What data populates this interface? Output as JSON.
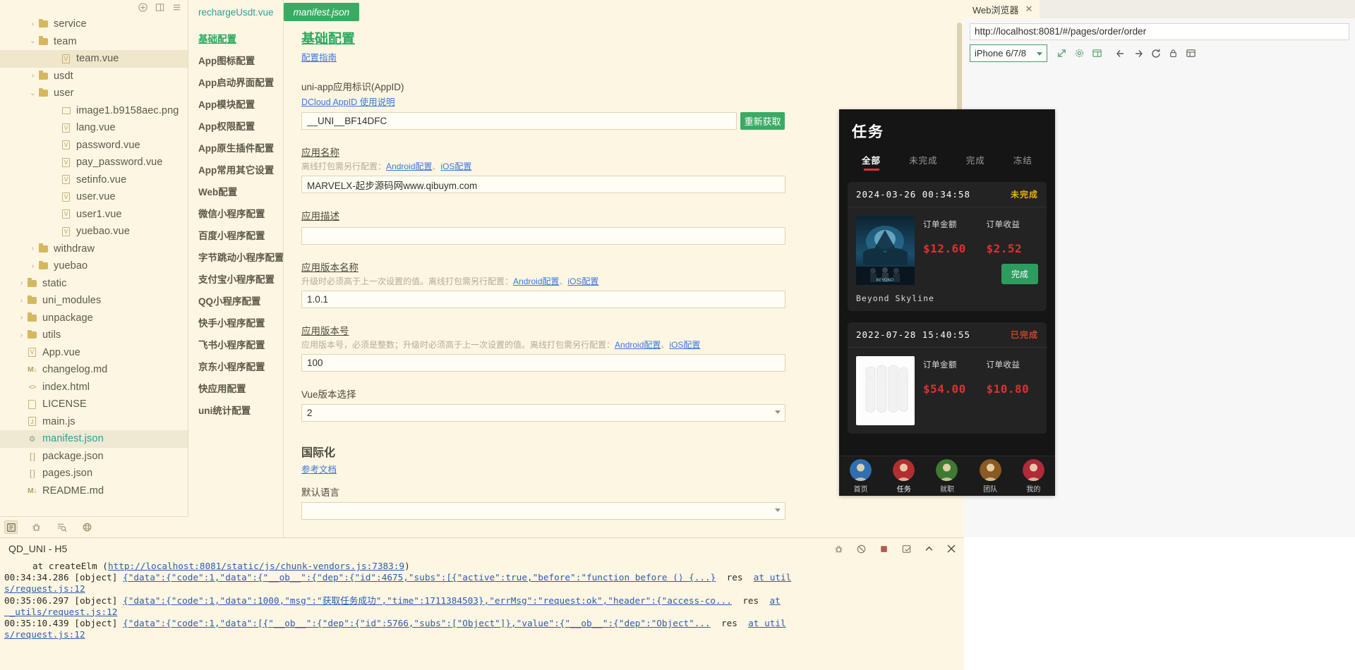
{
  "explorer": {
    "toolbar_icons": [
      "add-icon",
      "collapse-icon",
      "menu-icon"
    ],
    "items": [
      {
        "indent": 2,
        "twisty": "›",
        "icon": "folder-icon",
        "label": "service",
        "state": "collapsed"
      },
      {
        "indent": 2,
        "twisty": "⌄",
        "icon": "folder-open-icon",
        "label": "team",
        "state": "expanded"
      },
      {
        "indent": 4,
        "twisty": "",
        "icon": "vue-file-icon",
        "label": "team.vue",
        "state": "selected"
      },
      {
        "indent": 2,
        "twisty": "›",
        "icon": "folder-icon",
        "label": "usdt",
        "state": "collapsed"
      },
      {
        "indent": 2,
        "twisty": "⌄",
        "icon": "folder-open-icon",
        "label": "user",
        "state": "expanded"
      },
      {
        "indent": 4,
        "twisty": "",
        "icon": "image-file-icon",
        "label": "image1.b9158aec.png",
        "state": ""
      },
      {
        "indent": 4,
        "twisty": "",
        "icon": "vue-file-icon",
        "label": "lang.vue",
        "state": ""
      },
      {
        "indent": 4,
        "twisty": "",
        "icon": "vue-file-icon",
        "label": "password.vue",
        "state": ""
      },
      {
        "indent": 4,
        "twisty": "",
        "icon": "vue-file-icon",
        "label": "pay_password.vue",
        "state": ""
      },
      {
        "indent": 4,
        "twisty": "",
        "icon": "vue-file-icon",
        "label": "setinfo.vue",
        "state": ""
      },
      {
        "indent": 4,
        "twisty": "",
        "icon": "vue-file-icon",
        "label": "user.vue",
        "state": ""
      },
      {
        "indent": 4,
        "twisty": "",
        "icon": "vue-file-icon",
        "label": "user1.vue",
        "state": ""
      },
      {
        "indent": 4,
        "twisty": "",
        "icon": "vue-file-icon",
        "label": "yuebao.vue",
        "state": ""
      },
      {
        "indent": 2,
        "twisty": "›",
        "icon": "folder-icon",
        "label": "withdraw",
        "state": "collapsed"
      },
      {
        "indent": 2,
        "twisty": "›",
        "icon": "folder-icon",
        "label": "yuebao",
        "state": "collapsed"
      },
      {
        "indent": 1,
        "twisty": "›",
        "icon": "folder-icon",
        "label": "static",
        "state": "collapsed"
      },
      {
        "indent": 1,
        "twisty": "›",
        "icon": "folder-icon",
        "label": "uni_modules",
        "state": "collapsed"
      },
      {
        "indent": 1,
        "twisty": "›",
        "icon": "folder-icon",
        "label": "unpackage",
        "state": "collapsed"
      },
      {
        "indent": 1,
        "twisty": "›",
        "icon": "folder-icon",
        "label": "utils",
        "state": "collapsed"
      },
      {
        "indent": 1,
        "twisty": "",
        "icon": "vue-file-icon",
        "label": "App.vue",
        "state": ""
      },
      {
        "indent": 1,
        "twisty": "",
        "icon": "markdown-file-icon",
        "label": "changelog.md",
        "state": ""
      },
      {
        "indent": 1,
        "twisty": "",
        "icon": "html-file-icon",
        "label": "index.html",
        "state": ""
      },
      {
        "indent": 1,
        "twisty": "",
        "icon": "license-file-icon",
        "label": "LICENSE",
        "state": ""
      },
      {
        "indent": 1,
        "twisty": "",
        "icon": "js-file-icon",
        "label": "main.js",
        "state": ""
      },
      {
        "indent": 1,
        "twisty": "",
        "icon": "manifest-file-icon",
        "label": "manifest.json",
        "state": "active"
      },
      {
        "indent": 1,
        "twisty": "",
        "icon": "json-file-icon",
        "label": "package.json",
        "state": ""
      },
      {
        "indent": 1,
        "twisty": "",
        "icon": "json-file-icon",
        "label": "pages.json",
        "state": ""
      },
      {
        "indent": 1,
        "twisty": "",
        "icon": "markdown-file-icon",
        "label": "README.md",
        "state": ""
      }
    ],
    "footer_icons": [
      "explorer-icon",
      "debug-icon",
      "search-icon",
      "network-icon"
    ]
  },
  "editor_tabs": [
    {
      "label": "rechargeUsdt.vue",
      "active": false
    },
    {
      "label": "manifest.json",
      "active": true
    }
  ],
  "manifest_nav": [
    {
      "label": "基础配置",
      "current": true
    },
    {
      "label": "App图标配置",
      "current": false
    },
    {
      "label": "App启动界面配置",
      "current": false
    },
    {
      "label": "App模块配置",
      "current": false
    },
    {
      "label": "App权限配置",
      "current": false
    },
    {
      "label": "App原生插件配置",
      "current": false
    },
    {
      "label": "App常用其它设置",
      "current": false
    },
    {
      "label": "Web配置",
      "current": false
    },
    {
      "label": "微信小程序配置",
      "current": false
    },
    {
      "label": "百度小程序配置",
      "current": false
    },
    {
      "label": "字节跳动小程序配置",
      "current": false
    },
    {
      "label": "支付宝小程序配置",
      "current": false
    },
    {
      "label": "QQ小程序配置",
      "current": false
    },
    {
      "label": "快手小程序配置",
      "current": false
    },
    {
      "label": "飞书小程序配置",
      "current": false
    },
    {
      "label": "京东小程序配置",
      "current": false
    },
    {
      "label": "快应用配置",
      "current": false
    },
    {
      "label": "uni统计配置",
      "current": false
    }
  ],
  "form": {
    "section_title": "基础配置",
    "section_link": "配置指南",
    "appid_label": "uni-app应用标识(AppID)",
    "appid_link": "DCloud AppID 使用说明",
    "appid_value": "__UNI__BF14DFC",
    "appid_refresh_button": "重新获取",
    "appname_label": "应用名称",
    "appname_hint_prefix": "离线打包需另行配置：",
    "appname_hint_link1": "Android配置",
    "appname_hint_sep": "、",
    "appname_hint_link2": "iOS配置",
    "appname_value": "MARVELX-起步源码网www.qibuym.com",
    "appdesc_label": "应用描述",
    "appdesc_value": "",
    "appver_label": "应用版本名称",
    "appver_hint_prefix": "升级时必须高于上一次设置的值。离线打包需另行配置：",
    "appver_hint_link1": "Android配置",
    "appver_hint_link2": "iOS配置",
    "appver_value": "1.0.1",
    "appcode_label": "应用版本号",
    "appcode_hint_prefix": "应用版本号，必须是整数；升级时必须高于上一次设置的值。离线打包需另行配置：",
    "appcode_hint_link1": "Android配置",
    "appcode_hint_link2": "iOS配置",
    "appcode_value": "100",
    "vuever_label": "Vue版本选择",
    "vuever_value": "2",
    "i18n_title": "国际化",
    "i18n_link": "参考文档",
    "lang_label": "默认语言",
    "lang_value": ""
  },
  "browser": {
    "tab_label": "Web浏览器",
    "url": "http://localhost:8081/#/pages/order/order",
    "device": "iPhone 6/7/8",
    "toolbar_icons": [
      "open-external-icon",
      "settings-icon",
      "devtools-icon",
      "back-icon",
      "forward-icon",
      "reload-icon",
      "lock-icon",
      "layout-icon"
    ]
  },
  "phone": {
    "title": "任务",
    "tabs": [
      {
        "label": "全部",
        "active": true
      },
      {
        "label": "未完成",
        "active": false
      },
      {
        "label": "完成",
        "active": false
      },
      {
        "label": "冻结",
        "active": false
      }
    ],
    "cards": [
      {
        "datetime": "2024-03-26 00:34:58",
        "status": "未完成",
        "status_color": "#e8b20a",
        "amount_label": "订单金额",
        "amount_value": "$12.60",
        "profit_label": "订单收益",
        "profit_value": "$2.52",
        "action_button": "完成",
        "caption": "Beyond Skyline",
        "image": "movie-poster-thumbnail"
      },
      {
        "datetime": "2022-07-28 15:40:55",
        "status": "已完成",
        "status_color": "#c9442e",
        "amount_label": "订单金额",
        "amount_value": "$54.00",
        "profit_label": "订单收益",
        "profit_value": "$10.80",
        "action_button": "",
        "caption": "",
        "image": "white-socks-thumbnail"
      }
    ],
    "bottom_nav": [
      {
        "label": "首页",
        "icon": "home-avatar-icon",
        "active": false
      },
      {
        "label": "任务",
        "icon": "task-avatar-icon",
        "active": true
      },
      {
        "label": "就职",
        "icon": "job-avatar-icon",
        "active": false
      },
      {
        "label": "团队",
        "icon": "team-avatar-icon",
        "active": false
      },
      {
        "label": "我的",
        "icon": "profile-avatar-icon",
        "active": false
      }
    ]
  },
  "console": {
    "title": "QD_UNI - H5",
    "action_icons": [
      "filter-icon",
      "clear-icon",
      "stop-icon",
      "export-icon",
      "collapse-icon",
      "close-icon"
    ],
    "lines": [
      {
        "indent": true,
        "parts": [
          {
            "t": "at createElm (",
            "s": "plain"
          },
          {
            "t": "http://localhost:8081/static/js/chunk-vendors.js:7383:9",
            "s": "link"
          },
          {
            "t": ")",
            "s": "plain"
          }
        ]
      },
      {
        "indent": false,
        "parts": [
          {
            "t": "00:34:34.286 [object] ",
            "s": "plain"
          },
          {
            "t": "{\"data\":{\"code\":1,\"data\":{\"__ob__\":{\"dep\":{\"id\":4675,\"subs\":[{\"active\":true,\"before\":\"function before () {...}",
            "s": "link"
          },
          {
            "t": "  res  ",
            "s": "plain"
          },
          {
            "t": "at util",
            "s": "link"
          }
        ]
      },
      {
        "indent": false,
        "parts": [
          {
            "t": "s/request.js:12",
            "s": "link"
          }
        ]
      },
      {
        "indent": false,
        "parts": [
          {
            "t": "00:35:06.297 [object] ",
            "s": "plain"
          },
          {
            "t": "{\"data\":{\"code\":1,\"data\":1000,\"msg\":\"获取任务成功\",\"time\":1711384503},\"errMsg\":\"request:ok\",\"header\":{\"access-co...",
            "s": "link"
          },
          {
            "t": "  res  ",
            "s": "plain"
          },
          {
            "t": "at",
            "s": "link"
          }
        ]
      },
      {
        "indent": false,
        "parts": [
          {
            "t": " _utils/request.js:12",
            "s": "link"
          }
        ]
      },
      {
        "indent": false,
        "parts": [
          {
            "t": "00:35:10.439 [object] ",
            "s": "plain"
          },
          {
            "t": "{\"data\":{\"code\":1,\"data\":[{\"__ob__\":{\"dep\":{\"id\":5766,\"subs\":[\"Object\"]},\"value\":{\"__ob__\":{\"dep\":\"Object\"...",
            "s": "link"
          },
          {
            "t": "  res  ",
            "s": "plain"
          },
          {
            "t": "at util",
            "s": "link"
          }
        ]
      },
      {
        "indent": false,
        "parts": [
          {
            "t": "s/request.js:12",
            "s": "link"
          }
        ]
      }
    ]
  }
}
